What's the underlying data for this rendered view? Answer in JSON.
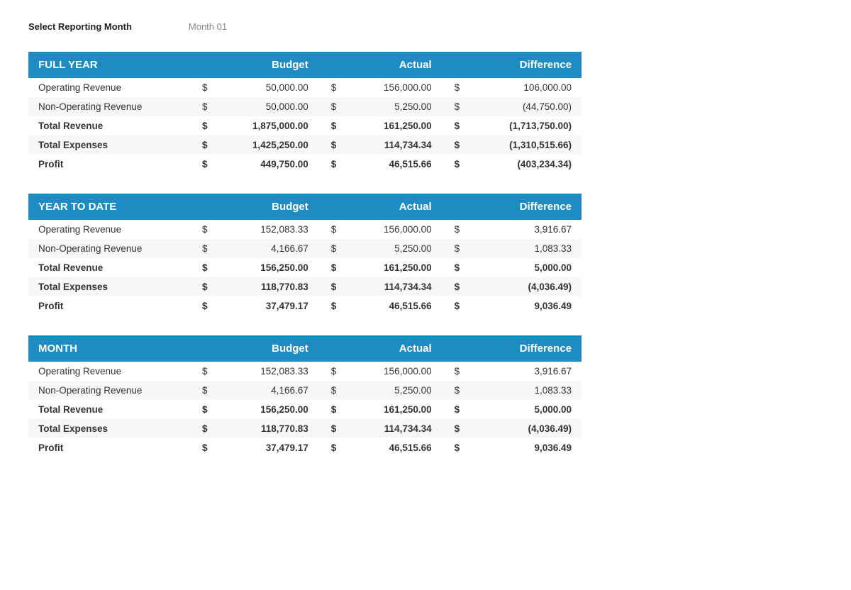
{
  "header": {
    "select_label": "Select Reporting Month",
    "month_value": "Month 01"
  },
  "sections": [
    {
      "id": "full-year",
      "title": "FULL YEAR",
      "col_budget": "Budget",
      "col_actual": "Actual",
      "col_diff": "Difference",
      "rows": [
        {
          "label": " Operating Revenue",
          "bold": false,
          "budget_sign": "$",
          "budget": "50,000.00",
          "actual_sign": "$",
          "actual": "156,000.00",
          "diff_sign": "$",
          "diff": "106,000.00"
        },
        {
          "label": " Non-Operating Revenue",
          "bold": false,
          "budget_sign": "$",
          "budget": "50,000.00",
          "actual_sign": "$",
          "actual": "5,250.00",
          "diff_sign": "$",
          "diff": "(44,750.00)"
        },
        {
          "label": "Total Revenue",
          "bold": true,
          "budget_sign": "$",
          "budget": "1,875,000.00",
          "actual_sign": "$",
          "actual": "161,250.00",
          "diff_sign": "$",
          "diff": "(1,713,750.00)"
        },
        {
          "label": "Total Expenses",
          "bold": true,
          "budget_sign": "$",
          "budget": "1,425,250.00",
          "actual_sign": "$",
          "actual": "114,734.34",
          "diff_sign": "$",
          "diff": "(1,310,515.66)"
        },
        {
          "label": "Profit",
          "bold": true,
          "budget_sign": "$",
          "budget": "449,750.00",
          "actual_sign": "$",
          "actual": "46,515.66",
          "diff_sign": "$",
          "diff": "(403,234.34)"
        }
      ]
    },
    {
      "id": "year-to-date",
      "title": "YEAR TO DATE",
      "col_budget": "Budget",
      "col_actual": "Actual",
      "col_diff": "Difference",
      "rows": [
        {
          "label": " Operating Revenue",
          "bold": false,
          "budget_sign": "$",
          "budget": "152,083.33",
          "actual_sign": "$",
          "actual": "156,000.00",
          "diff_sign": "$",
          "diff": "3,916.67"
        },
        {
          "label": " Non-Operating Revenue",
          "bold": false,
          "budget_sign": "$",
          "budget": "4,166.67",
          "actual_sign": "$",
          "actual": "5,250.00",
          "diff_sign": "$",
          "diff": "1,083.33"
        },
        {
          "label": "Total Revenue",
          "bold": true,
          "budget_sign": "$",
          "budget": "156,250.00",
          "actual_sign": "$",
          "actual": "161,250.00",
          "diff_sign": "$",
          "diff": "5,000.00"
        },
        {
          "label": "Total Expenses",
          "bold": true,
          "budget_sign": "$",
          "budget": "118,770.83",
          "actual_sign": "$",
          "actual": "114,734.34",
          "diff_sign": "$",
          "diff": "(4,036.49)"
        },
        {
          "label": "Profit",
          "bold": true,
          "budget_sign": "$",
          "budget": "37,479.17",
          "actual_sign": "$",
          "actual": "46,515.66",
          "diff_sign": "$",
          "diff": "9,036.49"
        }
      ]
    },
    {
      "id": "month",
      "title": "MONTH",
      "col_budget": "Budget",
      "col_actual": "Actual",
      "col_diff": "Difference",
      "rows": [
        {
          "label": " Operating Revenue",
          "bold": false,
          "budget_sign": "$",
          "budget": "152,083.33",
          "actual_sign": "$",
          "actual": "156,000.00",
          "diff_sign": "$",
          "diff": "3,916.67"
        },
        {
          "label": " Non-Operating Revenue",
          "bold": false,
          "budget_sign": "$",
          "budget": "4,166.67",
          "actual_sign": "$",
          "actual": "5,250.00",
          "diff_sign": "$",
          "diff": "1,083.33"
        },
        {
          "label": "Total Revenue",
          "bold": true,
          "budget_sign": "$",
          "budget": "156,250.00",
          "actual_sign": "$",
          "actual": "161,250.00",
          "diff_sign": "$",
          "diff": "5,000.00"
        },
        {
          "label": "Total Expenses",
          "bold": true,
          "budget_sign": "$",
          "budget": "118,770.83",
          "actual_sign": "$",
          "actual": "114,734.34",
          "diff_sign": "$",
          "diff": "(4,036.49)"
        },
        {
          "label": "Profit",
          "bold": true,
          "budget_sign": "$",
          "budget": "37,479.17",
          "actual_sign": "$",
          "actual": "46,515.66",
          "diff_sign": "$",
          "diff": "9,036.49"
        }
      ]
    }
  ]
}
